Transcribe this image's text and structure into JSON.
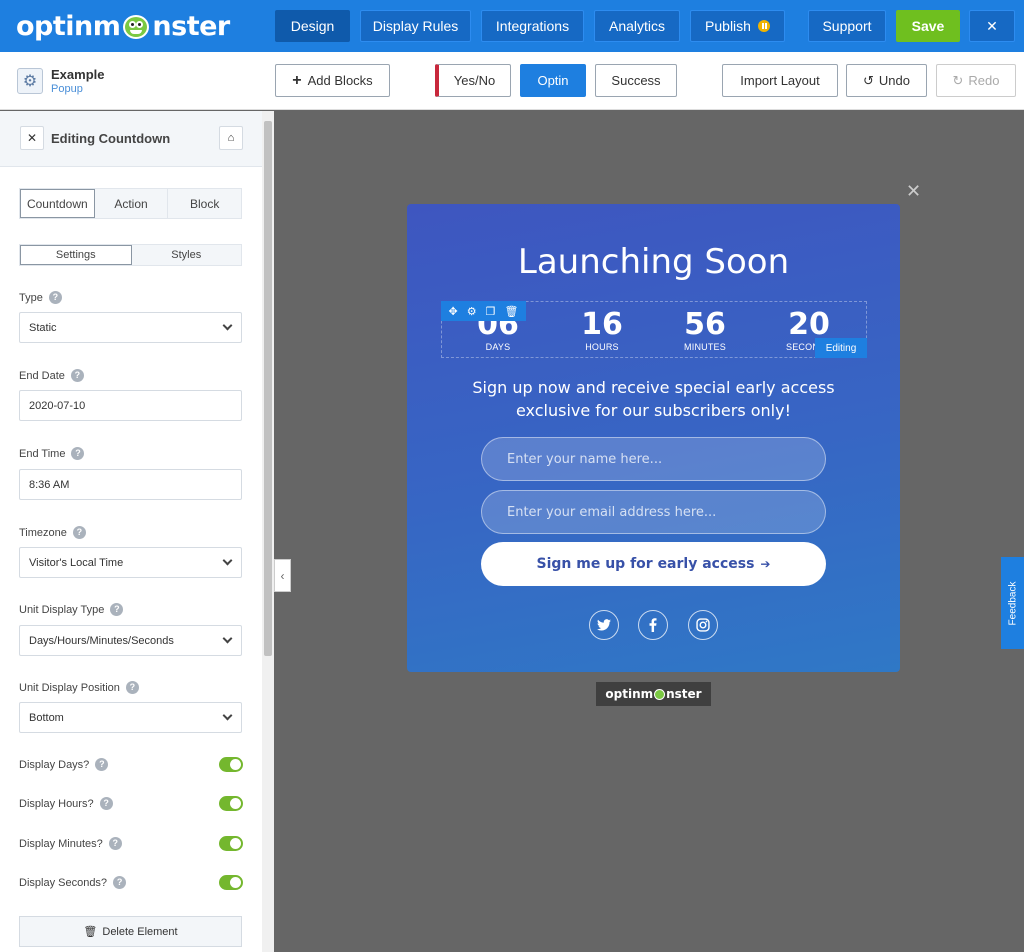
{
  "brand": {
    "logo_left": "optinm",
    "logo_right": "nster",
    "badge_left": "optinm",
    "badge_right": "nster"
  },
  "nav": {
    "design": "Design",
    "display_rules": "Display Rules",
    "integrations": "Integrations",
    "analytics": "Analytics",
    "publish": "Publish",
    "support": "Support",
    "save": "Save",
    "close": "✕"
  },
  "campaign": {
    "name": "Example",
    "type": "Popup"
  },
  "toolbar": {
    "add_blocks": "Add Blocks",
    "yes_no": "Yes/No",
    "optin": "Optin",
    "success": "Success",
    "import_layout": "Import Layout",
    "undo": "Undo",
    "redo": "Redo"
  },
  "panel": {
    "title": "Editing Countdown",
    "tabs": [
      "Countdown",
      "Action",
      "Block"
    ],
    "subtabs": [
      "Settings",
      "Styles"
    ],
    "fields": {
      "type": {
        "label": "Type",
        "value": "Static"
      },
      "end_date": {
        "label": "End Date",
        "value": "2020-07-10"
      },
      "end_time": {
        "label": "End Time",
        "value": "8:36 AM"
      },
      "timezone": {
        "label": "Timezone",
        "value": "Visitor's Local Time"
      },
      "unit_display_type": {
        "label": "Unit Display Type",
        "value": "Days/Hours/Minutes/Seconds"
      },
      "unit_display_position": {
        "label": "Unit Display Position",
        "value": "Bottom"
      }
    },
    "toggles": {
      "days": {
        "label": "Display Days?",
        "on": true
      },
      "hours": {
        "label": "Display Hours?",
        "on": true
      },
      "minutes": {
        "label": "Display Minutes?",
        "on": true
      },
      "seconds": {
        "label": "Display Seconds?",
        "on": true
      }
    },
    "delete": "Delete Element"
  },
  "popup": {
    "title": "Launching Soon",
    "countdown": [
      {
        "num": "06",
        "label": "DAYS"
      },
      {
        "num": "16",
        "label": "HOURS"
      },
      {
        "num": "56",
        "label": "MINUTES"
      },
      {
        "num": "20",
        "label": "SECONDS"
      }
    ],
    "editing_badge": "Editing",
    "subtitle": "Sign up now and receive special early access exclusive for our subscribers only!",
    "name_placeholder": "Enter your name here...",
    "email_placeholder": "Enter your email address here...",
    "button": "Sign me up for early access",
    "social": [
      "twitter-icon",
      "facebook-icon",
      "instagram-icon"
    ]
  },
  "feedback": "Feedback",
  "colors": {
    "primary": "#1e7fe0",
    "save": "#6fbf1f",
    "toggle_on": "#74b72e",
    "canvas": "#666666"
  }
}
